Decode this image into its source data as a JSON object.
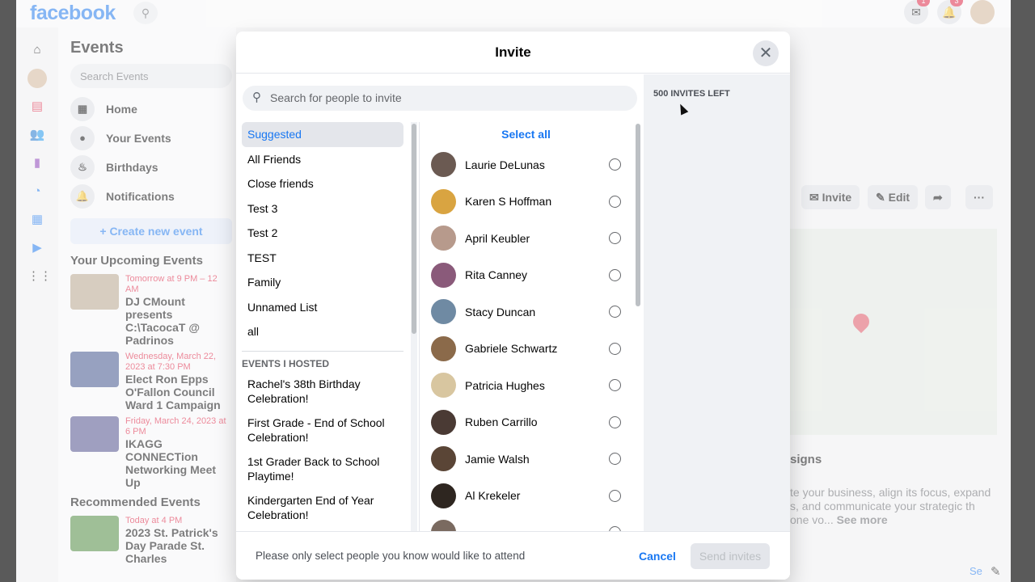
{
  "topbar": {
    "logo": "facebook",
    "messenger_badge": "1",
    "notif_badge": "3"
  },
  "events_pane": {
    "title": "Events",
    "search_placeholder": "Search Events",
    "nav": [
      "Home",
      "Your Events",
      "Birthdays",
      "Notifications"
    ],
    "create": "+ Create new event",
    "upcoming": "Your Upcoming Events",
    "recommended": "Recommended Events",
    "events": [
      {
        "date": "Tomorrow at 9 PM – 12 AM",
        "name": "DJ CMount presents C:\\TacocaT @ Padrinos"
      },
      {
        "date": "Wednesday, March 22, 2023 at 7:30 PM",
        "name": "Elect Ron Epps O'Fallon Council Ward 1 Campaign"
      },
      {
        "date": "Friday, March 24, 2023 at 6 PM",
        "name": "IKAGG CONNECTion Networking Meet Up"
      },
      {
        "date": "Today at 4 PM",
        "name": "2023 St. Patrick's Day Parade St. Charles"
      }
    ]
  },
  "event_actions": {
    "invite": "Invite",
    "edit": "Edit",
    "share": "➦",
    "more": "···"
  },
  "event_desc": {
    "heading": "signs",
    "text": "te your business, align its focus, expand s, and communicate your strategic th one vo...",
    "see_more": "See more",
    "footer_link": "Se"
  },
  "modal": {
    "title": "Invite",
    "search_placeholder": "Search for people to invite",
    "select_all": "Select all",
    "invites_left": "500 INVITES LEFT",
    "lists": [
      "Suggested",
      "All Friends",
      "Close friends",
      "Test 3",
      "Test 2",
      "TEST",
      "Family",
      "Unnamed List",
      "all"
    ],
    "hosted_header": "EVENTS I HOSTED",
    "hosted": [
      "Rachel's 38th Birthday Celebration!",
      "First Grade - End of School Celebration!",
      "1st Grader Back to School Playtime!",
      "Kindergarten End of Year Celebration!"
    ],
    "people": [
      {
        "name": "Laurie DeLunas",
        "color": "#6b5a52"
      },
      {
        "name": "Karen S Hoffman",
        "color": "#d9a441"
      },
      {
        "name": "April Keubler",
        "color": "#b79a8c"
      },
      {
        "name": "Rita Canney",
        "color": "#8a5a7a"
      },
      {
        "name": "Stacy Duncan",
        "color": "#6f8aa3"
      },
      {
        "name": "Gabriele Schwartz",
        "color": "#8b6a4a"
      },
      {
        "name": "Patricia Hughes",
        "color": "#d8c6a0"
      },
      {
        "name": "Ruben Carrillo",
        "color": "#4a3a34"
      },
      {
        "name": "Jamie Walsh",
        "color": "#5a4536"
      },
      {
        "name": "Al Krekeler",
        "color": "#2e2620"
      },
      {
        "name": "",
        "color": "#7a6a60"
      }
    ],
    "footer_note": "Please only select people you know would like to attend",
    "cancel": "Cancel",
    "send": "Send invites"
  }
}
